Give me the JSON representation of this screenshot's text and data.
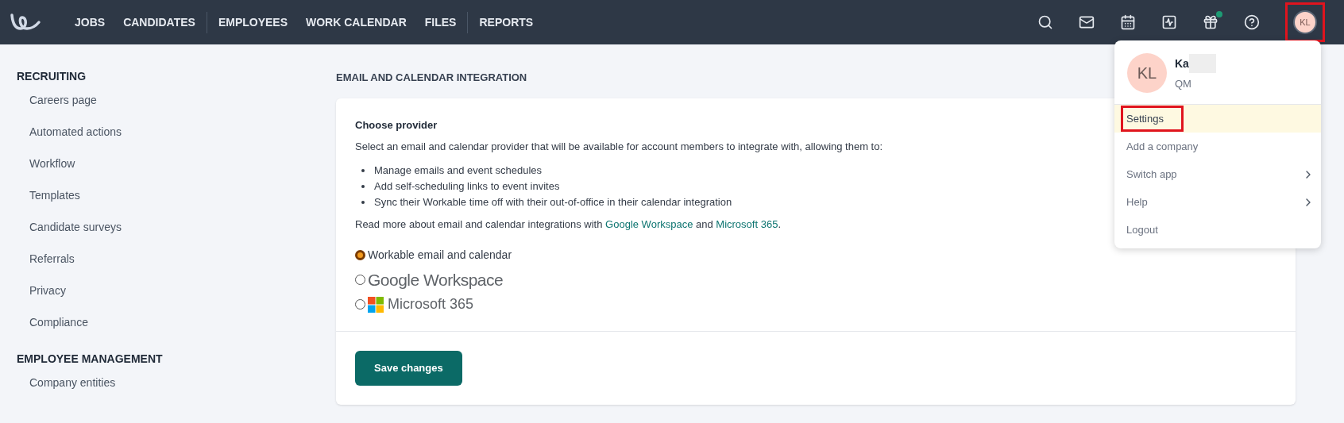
{
  "nav": {
    "items": [
      {
        "label": "JOBS",
        "divider_after": false
      },
      {
        "label": "CANDIDATES",
        "divider_after": true
      },
      {
        "label": "EMPLOYEES",
        "divider_after": false
      },
      {
        "label": "WORK CALENDAR",
        "divider_after": false
      },
      {
        "label": "FILES",
        "divider_after": true
      },
      {
        "label": "REPORTS",
        "divider_after": false
      }
    ],
    "icons": [
      {
        "kind": "search",
        "badge": false
      },
      {
        "kind": "mail",
        "badge": false
      },
      {
        "kind": "calendar",
        "badge": false
      },
      {
        "kind": "activity",
        "badge": false
      },
      {
        "kind": "gift",
        "badge": true
      },
      {
        "kind": "help",
        "badge": false
      }
    ],
    "avatar": {
      "initials": "KL",
      "highlighted": true
    }
  },
  "sidebar": [
    {
      "title": "RECRUITING",
      "items": [
        "Careers page",
        "Automated actions",
        "Workflow",
        "Templates",
        "Candidate surveys",
        "Referrals",
        "Privacy",
        "Compliance"
      ]
    },
    {
      "title": "EMPLOYEE MANAGEMENT",
      "items": [
        "Company entities"
      ]
    }
  ],
  "section_title": "EMAIL AND CALENDAR INTEGRATION",
  "card": {
    "heading": "Choose provider",
    "intro": "Select an email and calendar provider that will be available for account members to integrate with, allowing them to:",
    "bullets": [
      "Manage emails and event schedules",
      "Add self-scheduling links to event invites",
      "Sync their Workable time off with their out-of-office in their calendar integration"
    ],
    "read_more": {
      "before": "Read more about email and calendar integrations with ",
      "link1": "Google Workspace",
      "middle": " and ",
      "link2": "Microsoft 365",
      "after": "."
    },
    "options": [
      {
        "kind": "text",
        "label": "Workable email and calendar",
        "selected": true
      },
      {
        "kind": "google",
        "label": "Google Workspace",
        "selected": false
      },
      {
        "kind": "microsoft",
        "label": "Microsoft 365",
        "selected": false
      }
    ],
    "save_button": "Save changes"
  },
  "menu": {
    "avatar": "KL",
    "name": "Ka",
    "role": "QM",
    "items": [
      {
        "label": "Settings",
        "highlighted": true,
        "submenu": false
      },
      {
        "label": "Add a company",
        "highlighted": false,
        "submenu": false
      },
      {
        "label": "Switch app",
        "highlighted": false,
        "submenu": true
      },
      {
        "label": "Help",
        "highlighted": false,
        "submenu": true
      },
      {
        "label": "Logout",
        "highlighted": false,
        "submenu": false
      }
    ]
  }
}
